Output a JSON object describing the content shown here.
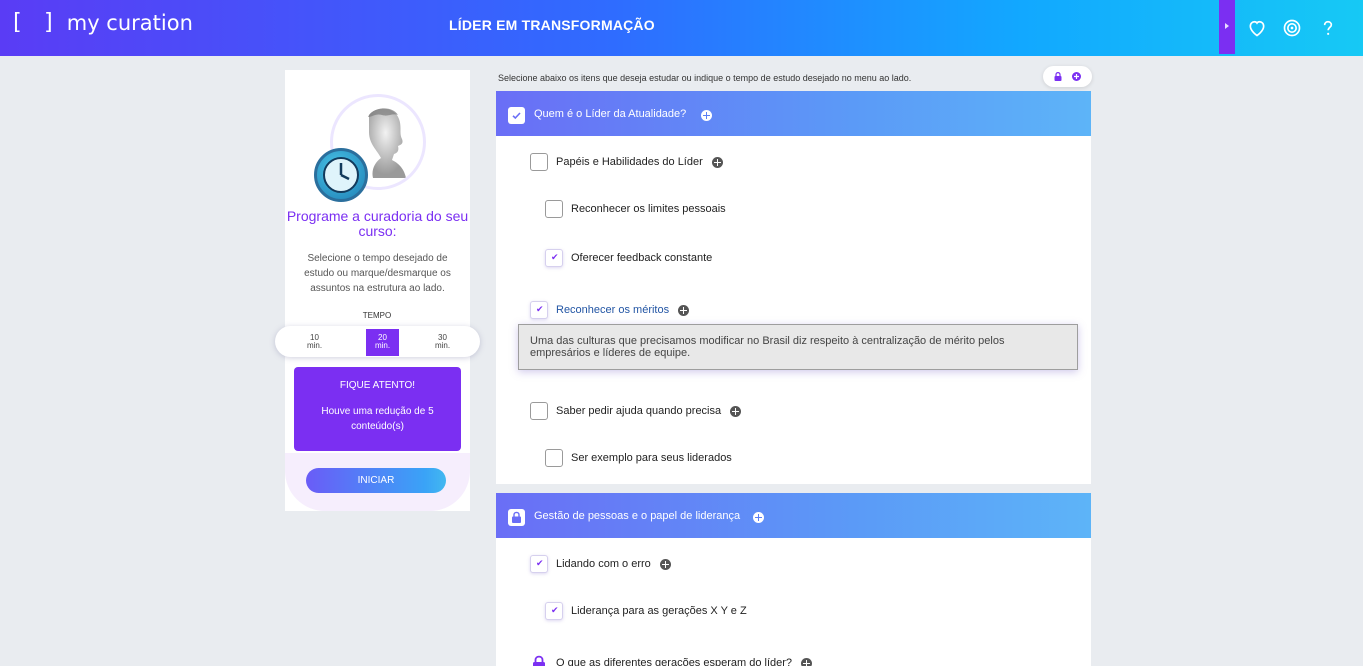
{
  "header": {
    "brand_brackets": "[ ]",
    "brand_name": "my curation",
    "page_title": "LÍDER EM TRANSFORMAÇÃO",
    "icons": [
      "heart-icon",
      "target-icon",
      "help-icon"
    ]
  },
  "sidebar": {
    "title": "Programe a curadoria do seu curso:",
    "description": "Selecione o tempo desejado de estudo ou marque/desmarque os assuntos na estrutura ao lado.",
    "tempo_label": "TEMPO",
    "time_options": [
      {
        "value": "10",
        "unit": "min."
      },
      {
        "value": "20",
        "unit": "min."
      },
      {
        "value": "30",
        "unit": "min."
      }
    ],
    "selected_time": "20",
    "alert_title": "FIQUE ATENTO!",
    "alert_body": "Houve uma redução de 5 conteúdo(s)",
    "start_label": "INICIAR"
  },
  "main": {
    "instructions": "Selecione abaixo os itens que deseja estudar ou indique o tempo de estudo desejado no menu ao lado.",
    "modules": [
      {
        "title": "Quem é o Líder da Atualidade?",
        "state": "checked",
        "items": [
          {
            "label": "Papéis e Habilidades do Líder",
            "checked": false,
            "has_plus": true
          },
          {
            "label": "Reconhecer os limites pessoais",
            "checked": false
          },
          {
            "label": "Oferecer feedback constante",
            "checked": true
          },
          {
            "label": "Reconhecer os méritos",
            "checked": true,
            "has_plus": true
          },
          {
            "label": "Saber pedir ajuda quando precisa",
            "checked": false,
            "has_plus": true
          },
          {
            "label": "Ser exemplo para seus liderados",
            "checked": false
          }
        ],
        "tooltip": "Uma das culturas que precisamos modificar no Brasil diz respeito à centralização de mérito pelos empresários e líderes de equipe."
      },
      {
        "title": "Gestão de pessoas e o papel de liderança",
        "state": "locked",
        "items": [
          {
            "label": "Lidando com o erro",
            "checked": true,
            "has_plus": true
          },
          {
            "label": "Liderança para as gerações X Y e Z",
            "checked": true
          },
          {
            "label": "O que as diferentes gerações esperam do líder?",
            "locked": true,
            "has_plus": true
          }
        ]
      }
    ]
  },
  "colors": {
    "accent_purple": "#7b2ff2",
    "header_gradient_start": "#5a3cf5",
    "header_gradient_end": "#16c9f5",
    "link_blue": "#2255a4"
  }
}
